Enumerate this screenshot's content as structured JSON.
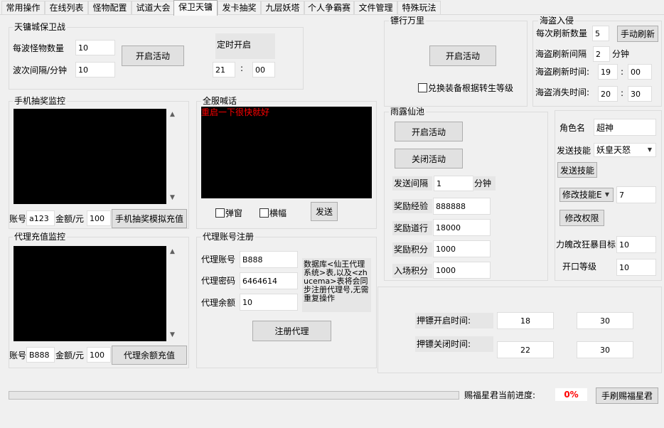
{
  "tabs": [
    "常用操作",
    "在线列表",
    "怪物配置",
    "试道大会",
    "保卫天镛",
    "发卡抽奖",
    "九层妖塔",
    "个人争霸赛",
    "文件管理",
    "特殊玩法"
  ],
  "defense": {
    "title": "天镛城保卫战",
    "wave_monsters_label": "每波怪物数量",
    "wave_monsters_value": "10",
    "wave_interval_label": "波次间隔/分钟",
    "wave_interval_value": "10",
    "start_button": "开启活动",
    "timer_label": "定时开启",
    "timer_hour": "21",
    "timer_colon": ":",
    "timer_minute": "00"
  },
  "phone_lottery": {
    "title": "手机抽奖监控",
    "account_label": "账号",
    "account_value": "a123",
    "amount_label": "金额/元",
    "amount_value": "100",
    "button": "手机抽奖模拟充值"
  },
  "broadcast": {
    "title": "全服喊话",
    "message": "重启一下很快就好",
    "popup_label": "弹窗",
    "banner_label": "横幅",
    "send_button": "发送"
  },
  "agent_recharge": {
    "title": "代理充值监控",
    "account_label": "账号",
    "account_value": "B888",
    "amount_label": "金额/元",
    "amount_value": "100",
    "button": "代理余额充值"
  },
  "agent_register": {
    "title": "代理账号注册",
    "account_label": "代理账号",
    "account_value": "B888",
    "password_label": "代理密码",
    "password_value": "6464614",
    "balance_label": "代理余额",
    "balance_value": "10",
    "note": "数据库<仙王代理系统>表,以及<zhucema>表将会同步注册代理号,无需重复操作",
    "register_button": "注册代理"
  },
  "biaoxing": {
    "title": "镖行万里",
    "start_button": "开启活动",
    "exchange_label": "兑换装备根据转生等级"
  },
  "pirate": {
    "title": "海盗入侵",
    "refresh_count_label": "每次刷新数量",
    "refresh_count_value": "5",
    "manual_refresh_button": "手动刷新",
    "refresh_interval_label": "海盗刷新间隔",
    "refresh_interval_value": "2",
    "refresh_interval_unit": "分钟",
    "refresh_time_label": "海盗刷新时间:",
    "refresh_hour": "19",
    "refresh_colon": ":",
    "refresh_minute": "00",
    "vanish_time_label": "海盗消失时间:",
    "vanish_hour": "20",
    "vanish_colon": ":",
    "vanish_minute": "30"
  },
  "yulu": {
    "title": "雨露仙池",
    "start_button": "开启活动",
    "stop_button": "关闭活动",
    "interval_label": "发送间隔",
    "interval_value": "1",
    "interval_unit": "分钟",
    "exp_label": "奖励经验",
    "exp_value": "888888",
    "dao_label": "奖励道行",
    "dao_value": "18000",
    "points_label": "奖励积分",
    "points_value": "1000",
    "entry_label": "入场积分",
    "entry_value": "1000"
  },
  "role": {
    "name_label": "角色名",
    "name_value": "超神",
    "skill_label": "发送技能",
    "skill_value": "妖皇天怒",
    "send_skill_button": "发送技能",
    "modify_skill_value": "修改技能E",
    "modify_skill_number": "7",
    "modify_perm_button": "修改权限",
    "target_label": "力魄改狂暴目标",
    "target_value": "10",
    "open_level_label": "开口等级",
    "open_level_value": "10"
  },
  "escort": {
    "open_label": "押镖开启时间:",
    "open_hour": "18",
    "open_minute": "30",
    "close_label": "押镖关闭时间:",
    "close_hour": "22",
    "close_minute": "30"
  },
  "status": {
    "progress_label": "赐福星君当前进度:",
    "progress_percent": "0%",
    "progress_fraction": 0,
    "button": "手刷赐福星君"
  },
  "colors": {
    "accent_red": "#ff0000",
    "log_bg": "#000000"
  }
}
